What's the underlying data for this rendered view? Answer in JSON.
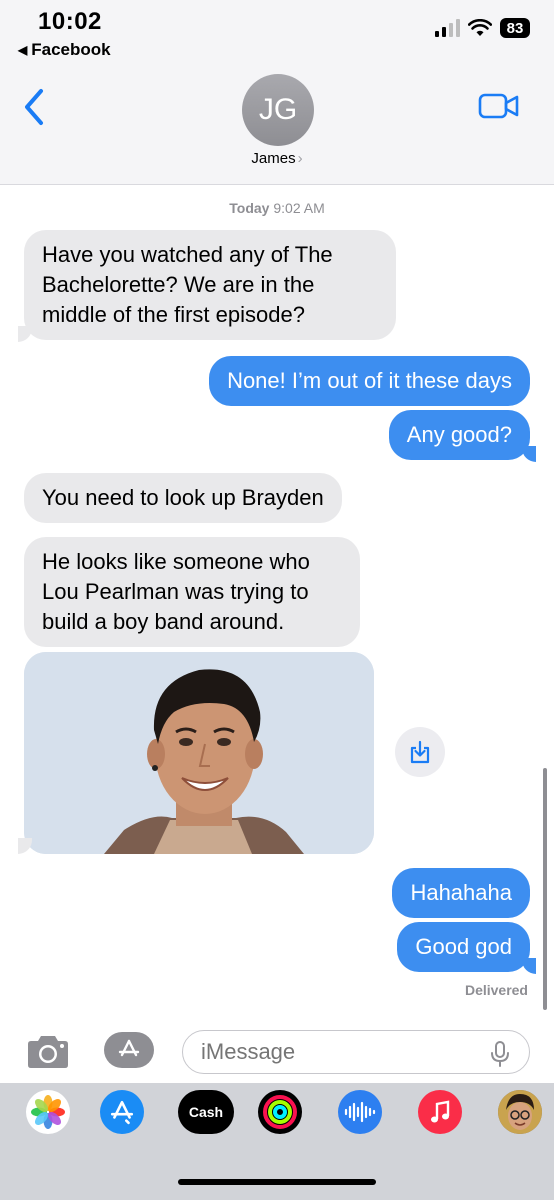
{
  "status_bar": {
    "time": "10:02",
    "back_app_label": "Facebook",
    "battery": "83"
  },
  "header": {
    "avatar_initials": "JG",
    "contact_name": "James",
    "back_icon": "chevron-left-icon",
    "video_icon": "video-call-icon"
  },
  "conversation": {
    "timestamp_day": "Today",
    "timestamp_time": "9:02 AM",
    "messages": [
      {
        "from": "them",
        "text": "Have you watched any of The Bachelorette? We are in the middle of the first episode?"
      },
      {
        "from": "me",
        "text": "None! I’m out of it these days"
      },
      {
        "from": "me",
        "text": "Any good?"
      },
      {
        "from": "them",
        "text": "You need to look up Brayden"
      },
      {
        "from": "them",
        "text": "He looks like someone who Lou Pearlman was trying to build a boy band around."
      },
      {
        "from": "them",
        "type": "photo"
      },
      {
        "from": "me",
        "text": "Hahahaha"
      },
      {
        "from": "me",
        "text": "Good god"
      }
    ],
    "delivered": "Delivered"
  },
  "compose": {
    "placeholder": "iMessage"
  },
  "app_tray": [
    "photos-icon",
    "app-store-icon",
    "apple-cash-icon",
    "activity-icon",
    "audio-message-icon",
    "music-icon",
    "memoji-icon"
  ],
  "app_tray_labels": {
    "cash": "Cash"
  },
  "colors": {
    "outgoing_bubble": "#3d8ef0",
    "incoming_bubble": "#e9e9eb",
    "accent": "#1a7cf5"
  }
}
